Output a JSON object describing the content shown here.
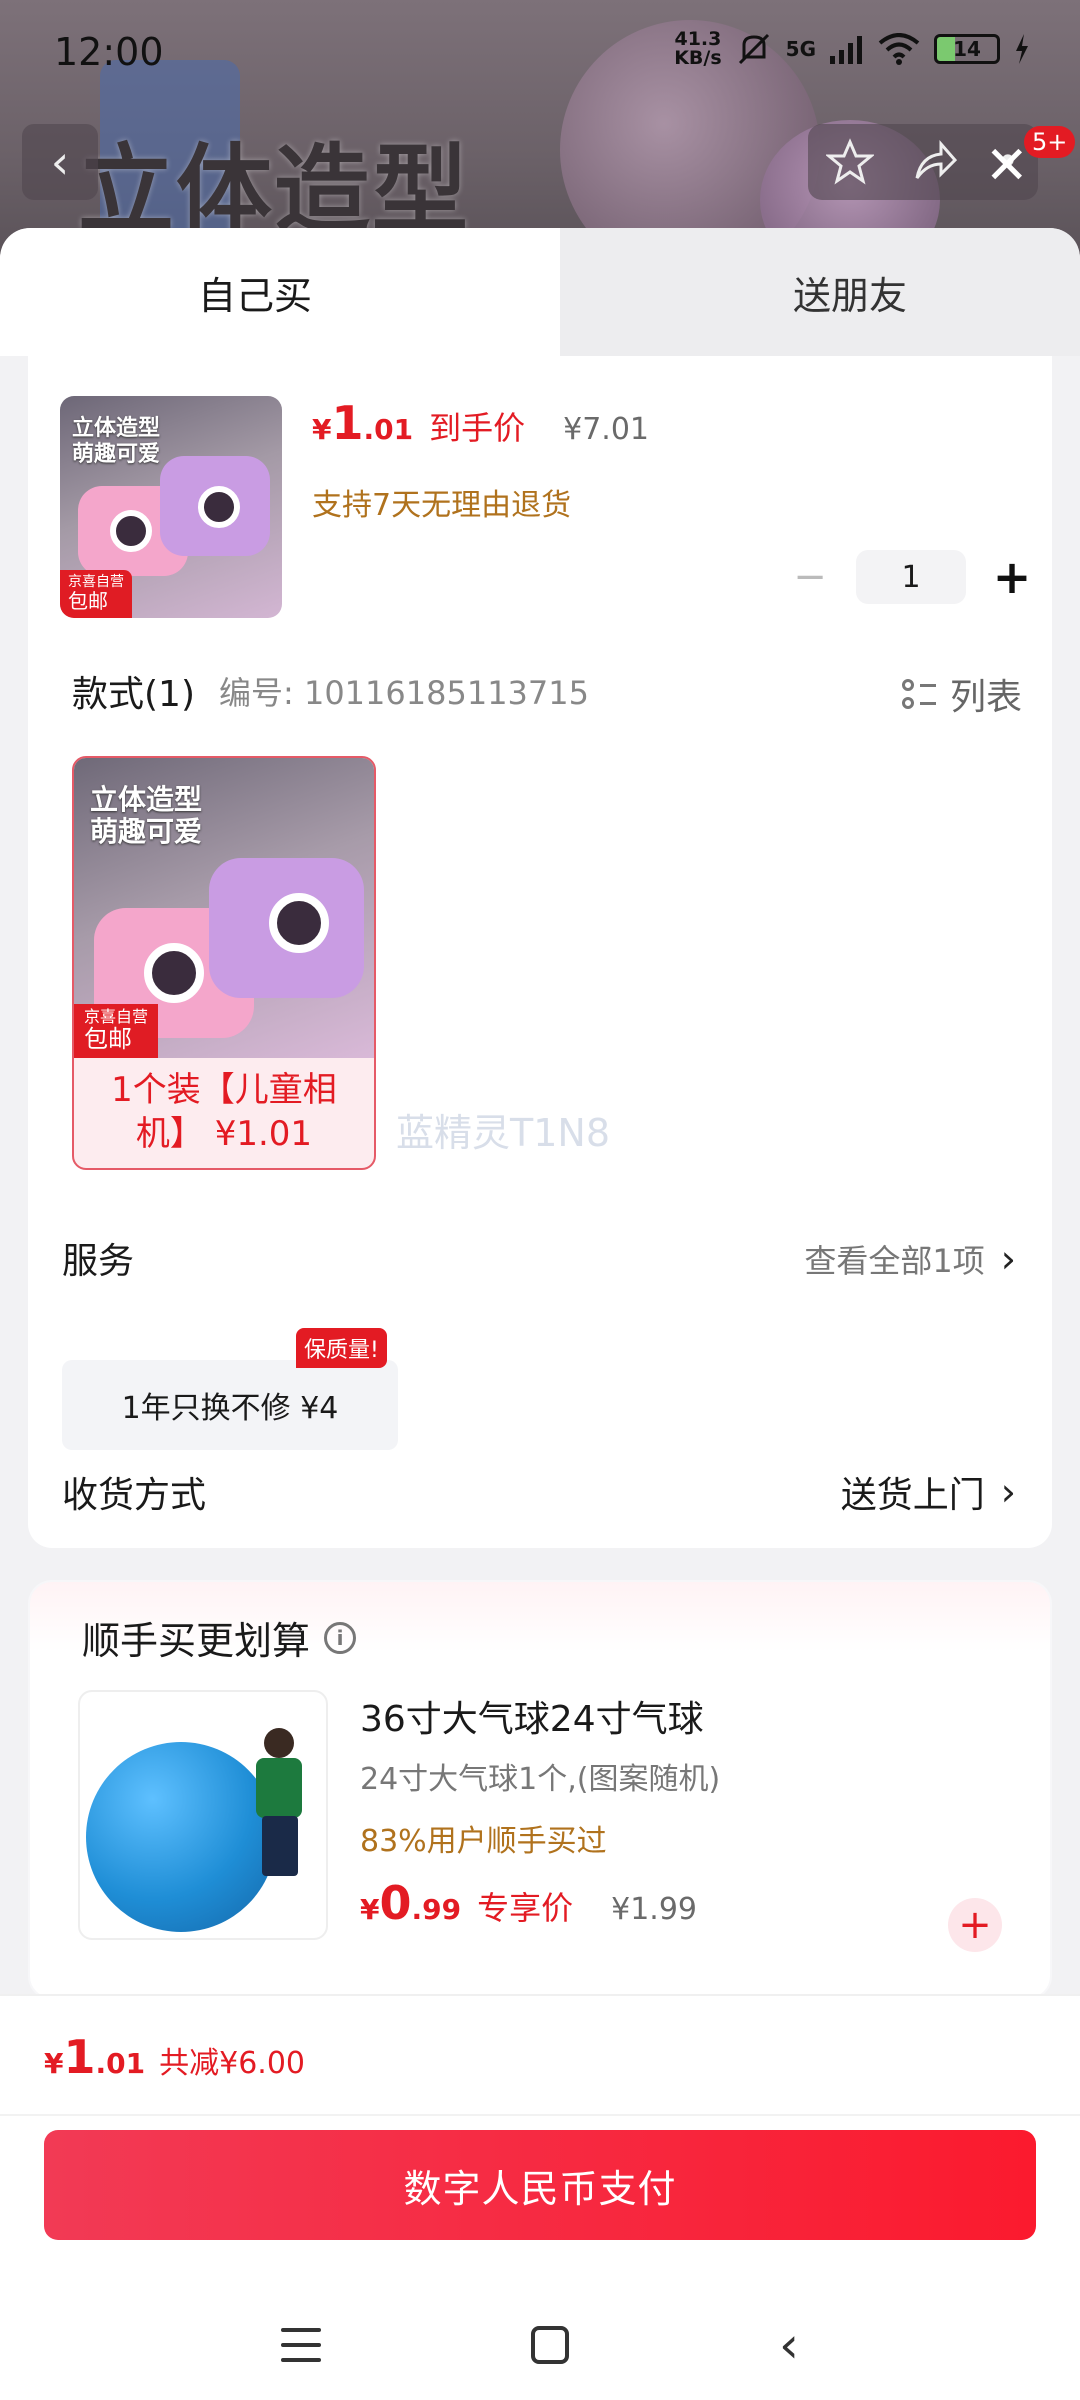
{
  "status_bar": {
    "time": "12:00",
    "speed_value": "41.3",
    "speed_unit": "KB/s",
    "network": "5G",
    "battery": "14"
  },
  "header": {
    "background_title": "立体造型",
    "badge": "5+"
  },
  "tabs": [
    {
      "label": "自己买",
      "active": true
    },
    {
      "label": "送朋友",
      "active": false
    }
  ],
  "product": {
    "thumb_caption": "立体造型\n萌趣可爱",
    "thumb_tag_top": "京喜自营",
    "thumb_tag_bottom": "包邮",
    "price_currency": "¥",
    "price_int": "1",
    "price_dec": ".01",
    "price_label": "到手价",
    "original_price": "¥7.01",
    "return_policy": "支持7天无理由退货",
    "quantity": "1"
  },
  "style_section": {
    "title": "款式(1)",
    "code": "编号: 10116185113715",
    "list_label": "列表",
    "option": {
      "caption": "立体造型\n萌趣可爱",
      "tag_top": "京喜自营",
      "tag_bottom": "包邮",
      "label": "1个装【儿童相机】 ¥1.01"
    }
  },
  "watermark": "蓝精灵T1N8",
  "service": {
    "label": "服务",
    "view_all": "查看全部1项",
    "chip": "1年只换不修  ¥4",
    "badge": "保质量!"
  },
  "delivery": {
    "label": "收货方式",
    "value": "送货上门"
  },
  "addon": {
    "title": "顺手买更划算",
    "name": "36寸大气球24寸气球",
    "desc": "24寸大气球1个,(图案随机)",
    "bought": "83%用户顺手买过",
    "price_currency": "¥",
    "price_int": "0",
    "price_dec": ".99",
    "price_label": "专享价",
    "original_price": "¥1.99"
  },
  "footer": {
    "price_currency": "¥",
    "price_int": "1",
    "price_dec": ".01",
    "discount": "共减¥6.00",
    "pay_button": "数字人民币支付"
  },
  "colors": {
    "accent": "#e31b23",
    "gold": "#b0721d"
  }
}
